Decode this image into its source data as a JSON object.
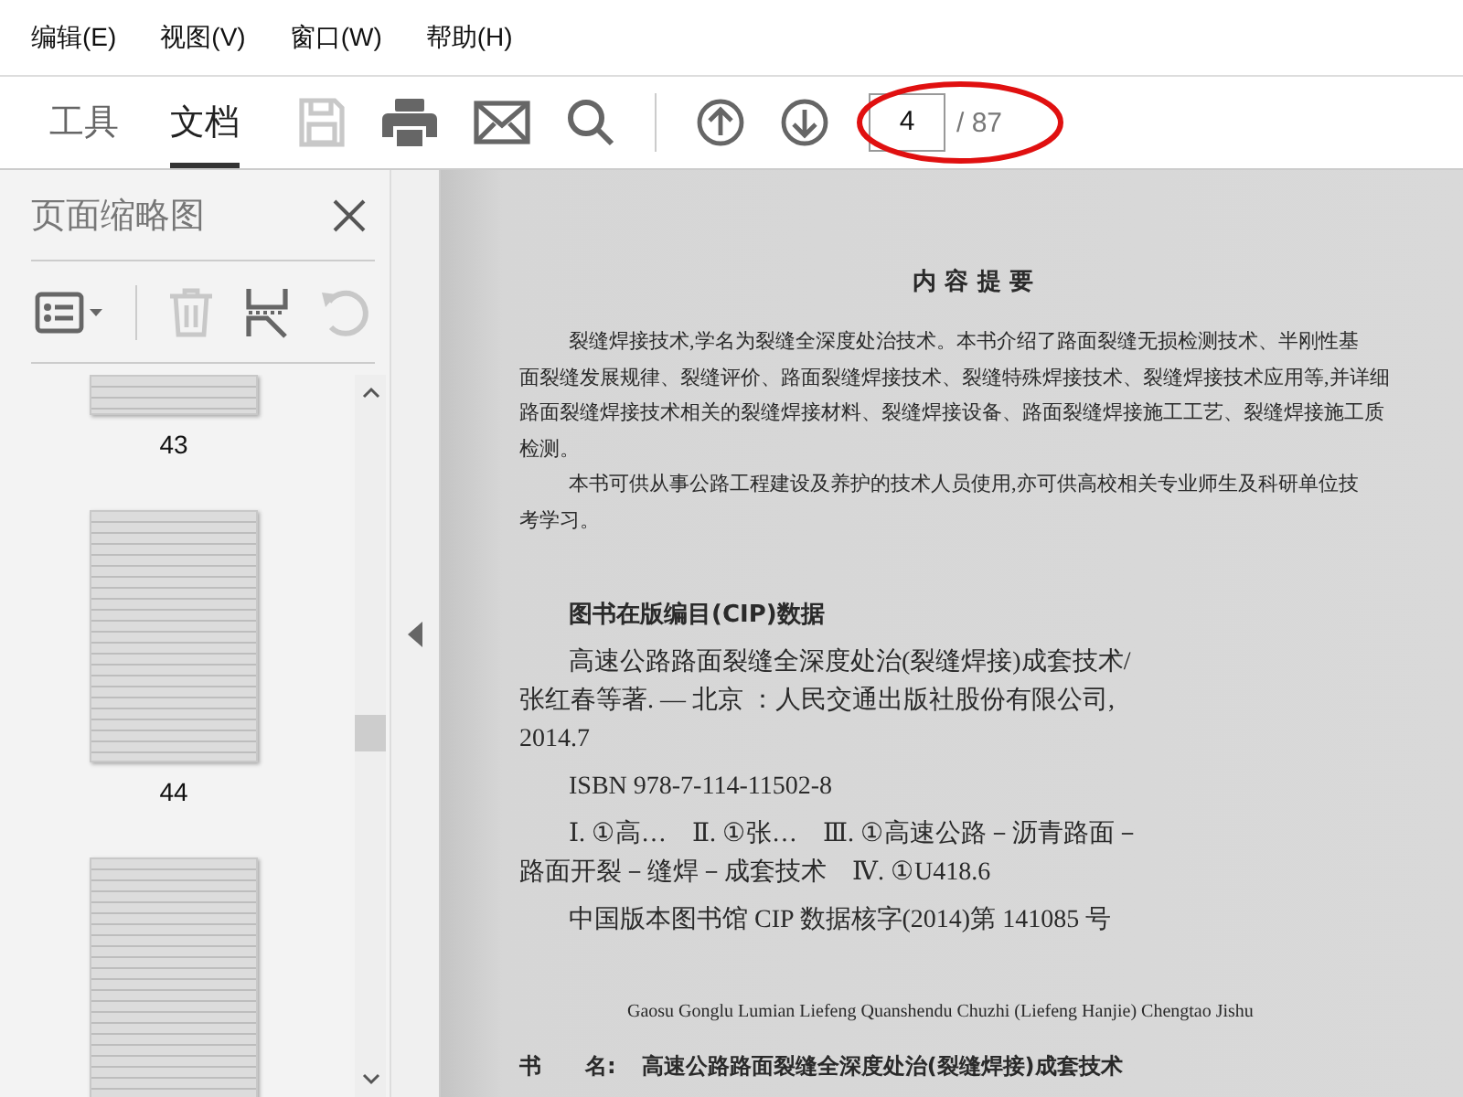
{
  "menu": [
    {
      "label": "编辑(E)"
    },
    {
      "label": "视图(V)"
    },
    {
      "label": "窗口(W)"
    },
    {
      "label": "帮助(H)"
    }
  ],
  "tabs": [
    {
      "label": "工具",
      "selected": false
    },
    {
      "label": "文档",
      "selected": true
    }
  ],
  "toolbar": [
    {
      "kind": "save",
      "disabled": true
    },
    {
      "kind": "print",
      "disabled": false
    },
    {
      "kind": "mail",
      "disabled": false
    },
    {
      "kind": "search",
      "disabled": false
    },
    {
      "kind": "divider"
    },
    {
      "kind": "up",
      "disabled": false
    },
    {
      "kind": "down",
      "disabled": false
    }
  ],
  "page_nav": {
    "current": "4",
    "total": "/ 87"
  },
  "thumbnails_panel": {
    "title": "页面缩略图",
    "tools": [
      {
        "kind": "options",
        "disabled": false
      },
      {
        "kind": "divider"
      },
      {
        "kind": "delete",
        "disabled": true
      },
      {
        "kind": "extract",
        "disabled": false
      },
      {
        "kind": "rotate",
        "disabled": true
      }
    ],
    "thumbnails": [
      {
        "kind": "partial",
        "label": "43"
      },
      {
        "kind": "full",
        "label": "44"
      },
      {
        "kind": "cut"
      }
    ]
  },
  "document": {
    "heading": "内 容 提 要",
    "summary": [
      [
        "裂缝焊接技术,学名为裂缝全深度处治技术。本书介绍了路面裂缝无损检测技术、半刚性基",
        "面裂缝发展规律、裂缝评价、路面裂缝焊接技术、裂缝特殊焊接技术、裂缝焊接技术应用等,并详细",
        "路面裂缝焊接技术相关的裂缝焊接材料、裂缝焊接设备、路面裂缝焊接施工工艺、裂缝焊接施工质",
        "检测。"
      ],
      [
        "本书可供从事公路工程建设及养护的技术人员使用,亦可供高校相关专业师生及科研单位技",
        "考学习。"
      ]
    ],
    "cip_heading": "图书在版编目(CIP)数据",
    "cip": [
      [
        "高速公路路面裂缝全深度处治(裂缝焊接)成套技术/",
        "张红春等著. — 北京 ：人民交通出版社股份有限公司,",
        "2014.7"
      ],
      [
        "ISBN 978-7-114-11502-8"
      ],
      [
        "Ⅰ. ①高…　Ⅱ. ①张…　Ⅲ. ①高速公路－沥青路面－",
        "路面开裂－缝焊－成套技术　Ⅳ. ①U418.6"
      ],
      [
        "中国版本图书馆 CIP 数据核字(2014)第 141085 号"
      ]
    ],
    "pinyin": "Gaosu Gonglu Lumian Liefeng Quanshendu Chuzhi (Liefeng Hanjie) Chengtao Jishu",
    "book_name": {
      "label": "书　　名:",
      "value": "高速公路路面裂缝全深度处治(裂缝焊接)成套技术"
    }
  }
}
